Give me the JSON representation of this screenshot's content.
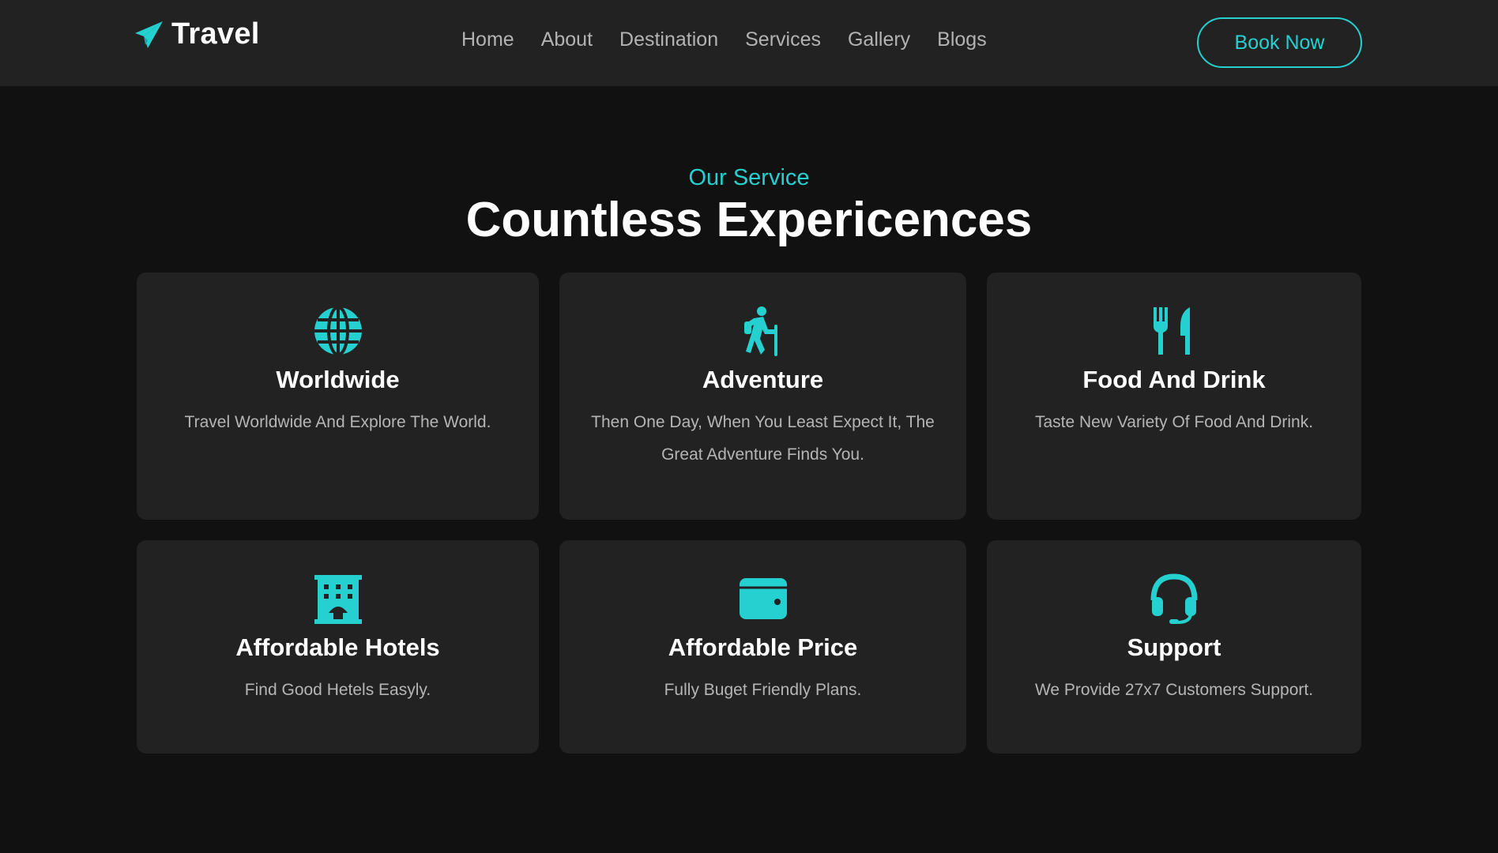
{
  "brand": {
    "name": "Travel",
    "icon": "paper-plane-icon"
  },
  "nav": {
    "links": [
      "Home",
      "About",
      "Destination",
      "Services",
      "Gallery",
      "Blogs"
    ],
    "cta_label": "Book Now"
  },
  "section": {
    "eyebrow": "Our Service",
    "heading": "Countless Expericences"
  },
  "services": [
    {
      "icon": "globe-icon",
      "title": "Worldwide",
      "description": "Travel Worldwide And Explore The World."
    },
    {
      "icon": "hiking-icon",
      "title": "Adventure",
      "description": "Then One Day, When You Least Expect It, The Great Adventure Finds You."
    },
    {
      "icon": "utensils-icon",
      "title": "Food And Drink",
      "description": "Taste New Variety Of Food And Drink."
    },
    {
      "icon": "hotel-icon",
      "title": "Affordable Hotels",
      "description": "Find Good Hetels Easyly."
    },
    {
      "icon": "wallet-icon",
      "title": "Affordable Price",
      "description": "Fully Buget Friendly Plans."
    },
    {
      "icon": "headset-icon",
      "title": "Support",
      "description": "We Provide 27x7 Customers Support."
    }
  ],
  "colors": {
    "accent": "#24d0d0",
    "page_background": "#111111",
    "surface": "#222222",
    "text": "#ffffff",
    "muted_text": "#b5b5b5"
  }
}
